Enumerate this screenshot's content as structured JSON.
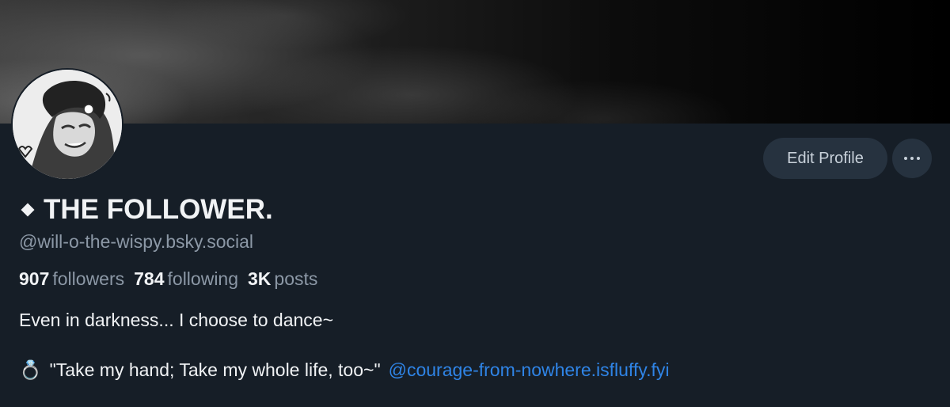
{
  "profile": {
    "display_name": "THE FOLLOWER.",
    "handle": "@will-o-the-wispy.bsky.social",
    "avatar_icon": "grayscale-character-avatar",
    "bio_line1": "Even in darkness... I choose to dance~",
    "bio_line2_emoji": "💍",
    "bio_line2_text": "\"Take my hand; Take my whole life, too~\"",
    "bio_line2_link": "@courage-from-nowhere.isfluffy.fyi"
  },
  "stats": {
    "followers_count": "907",
    "followers_label": "followers",
    "following_count": "784",
    "following_label": "following",
    "posts_count": "3K",
    "posts_label": "posts"
  },
  "actions": {
    "edit_profile_label": "Edit Profile",
    "more_icon": "ellipsis-icon"
  },
  "colors": {
    "background": "#161e27",
    "button_bg": "#26323f",
    "muted_text": "#8c98a6",
    "link": "#2f84e6"
  }
}
